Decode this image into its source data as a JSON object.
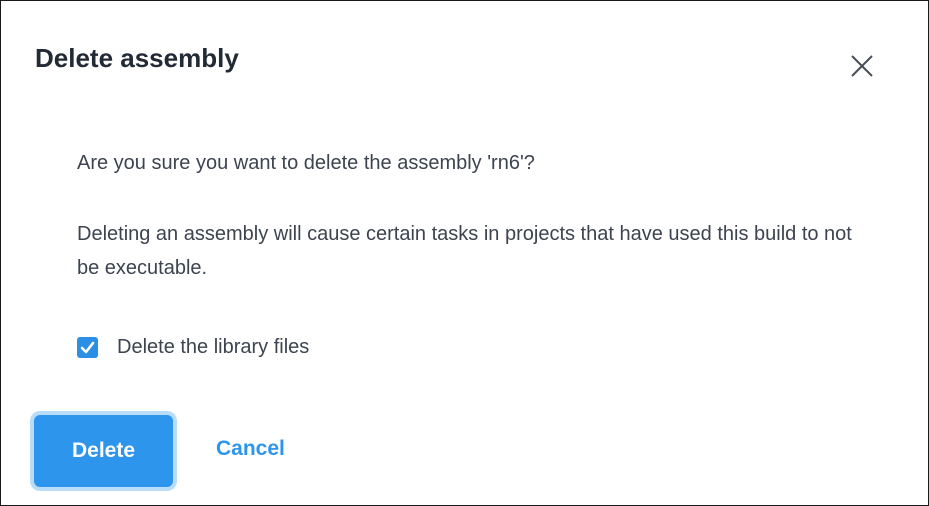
{
  "dialog": {
    "title": "Delete assembly",
    "close_icon": "close-icon",
    "question": "Are you sure you want to delete the assembly 'rn6'?",
    "warning": "Deleting an assembly will cause certain tasks in projects that have used this build to not be executable.",
    "checkbox": {
      "label": "Delete the library files",
      "checked": true,
      "icon": "checkmark-icon"
    },
    "buttons": {
      "delete_label": "Delete",
      "cancel_label": "Cancel"
    }
  },
  "colors": {
    "accent": "#2e95ec",
    "focus_ring": "#b9dcf9",
    "title_text": "#222a35",
    "body_text": "#3d4450"
  }
}
